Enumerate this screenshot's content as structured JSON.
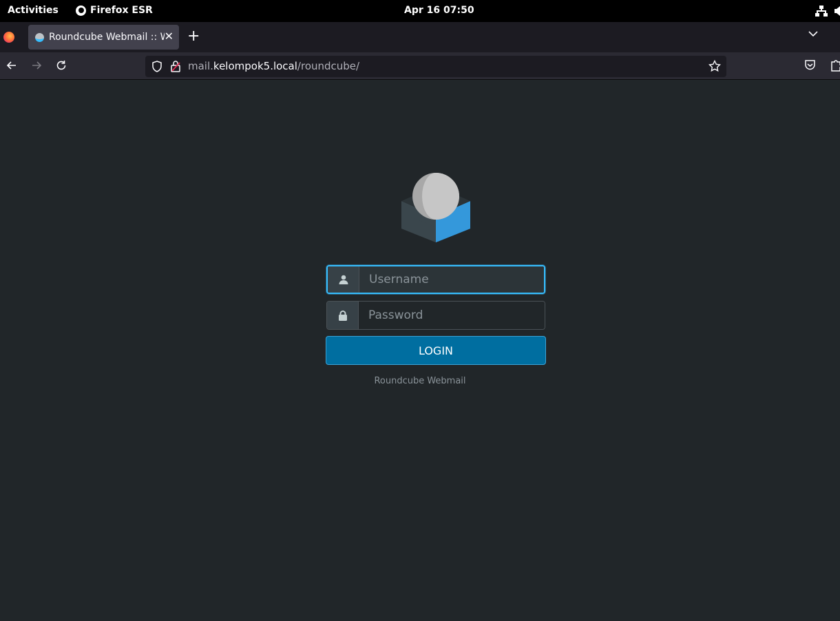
{
  "system": {
    "activities": "Activities",
    "app_name": "Firefox ESR",
    "clock": "Apr 16  07:50"
  },
  "browser": {
    "tab_title": "Roundcube Webmail :: Welcome to Roundcube Webmail",
    "url_host_prefix": "mail.",
    "url_host": "kelompok5.local",
    "url_path": "/roundcube/"
  },
  "login": {
    "username_placeholder": "Username",
    "password_placeholder": "Password",
    "login_label": "LOGIN",
    "footer": "Roundcube Webmail"
  },
  "colors": {
    "page_bg": "#212629",
    "accent": "#37beff",
    "button_bg": "#006ea0"
  }
}
